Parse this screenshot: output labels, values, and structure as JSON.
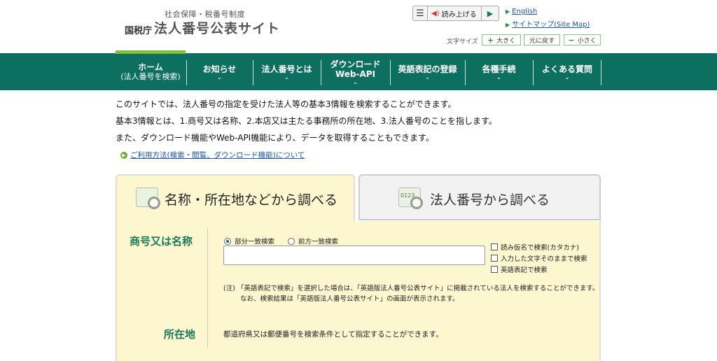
{
  "header": {
    "subtitle": "社会保障・税番号制度",
    "agency": "国税庁",
    "title": "法人番号公表サイト",
    "read_aloud_label": "読み上げる",
    "english_link": "English",
    "sitemap_link": "サイトマップ(Site Map)",
    "font_size_label": "文字サイズ",
    "font_large": "大きく",
    "font_reset": "元に戻す",
    "font_small": "小さく"
  },
  "nav": {
    "items": [
      {
        "line1": "ホーム",
        "line2": "(法人番号を検索)"
      },
      {
        "line1": "お知らせ"
      },
      {
        "line1": "法人番号とは"
      },
      {
        "line1": "ダウンロード",
        "line2": "Web-API"
      },
      {
        "line1": "英語表記の登録"
      },
      {
        "line1": "各種手続"
      },
      {
        "line1": "よくある質問"
      }
    ]
  },
  "intro": {
    "line1": "このサイトでは、法人番号の指定を受けた法人等の基本3情報を検索することができます。",
    "line2": "基本3情報とは、1.商号又は名称、2.本店又は主たる事務所の所在地、3.法人番号のことを指します。",
    "line3": "また、ダウンロード機能やWeb-API機能により、データを取得することもできます。",
    "usage_link": "ご利用方法(検索・閲覧、ダウンロード機能)について"
  },
  "tabs": {
    "name_search": "名称・所在地などから調べる",
    "number_search": "法人番号から調べる",
    "number_icon_text": "0123"
  },
  "form": {
    "name_label": "商号又は名称",
    "radio_partial": "部分一致検索",
    "radio_prefix": "前方一致検索",
    "name_value": "",
    "chk_kana": "読み仮名で検索(カタカナ)",
    "chk_asis": "入力した文字そのままで検索",
    "chk_english": "英語表記で検索",
    "note_line1": "(注) 「英語表記で検索」を選択した場合は、「英語版法人番号公表サイト」に掲載されている法人を検索することができます。",
    "note_line2": "なお、検索結果は「英語版法人番号公表サイト」の画面が表示されます。",
    "location_label": "所在地",
    "location_text": "都道府県又は郵便番号を検索条件として指定することができます。"
  },
  "colors": {
    "nav_bg": "#0c6f5f",
    "active_bar": "#7fbf3f",
    "panel_bg": "#fdf7d0",
    "link": "#1a56a8",
    "label_green": "#1a7a5a"
  }
}
